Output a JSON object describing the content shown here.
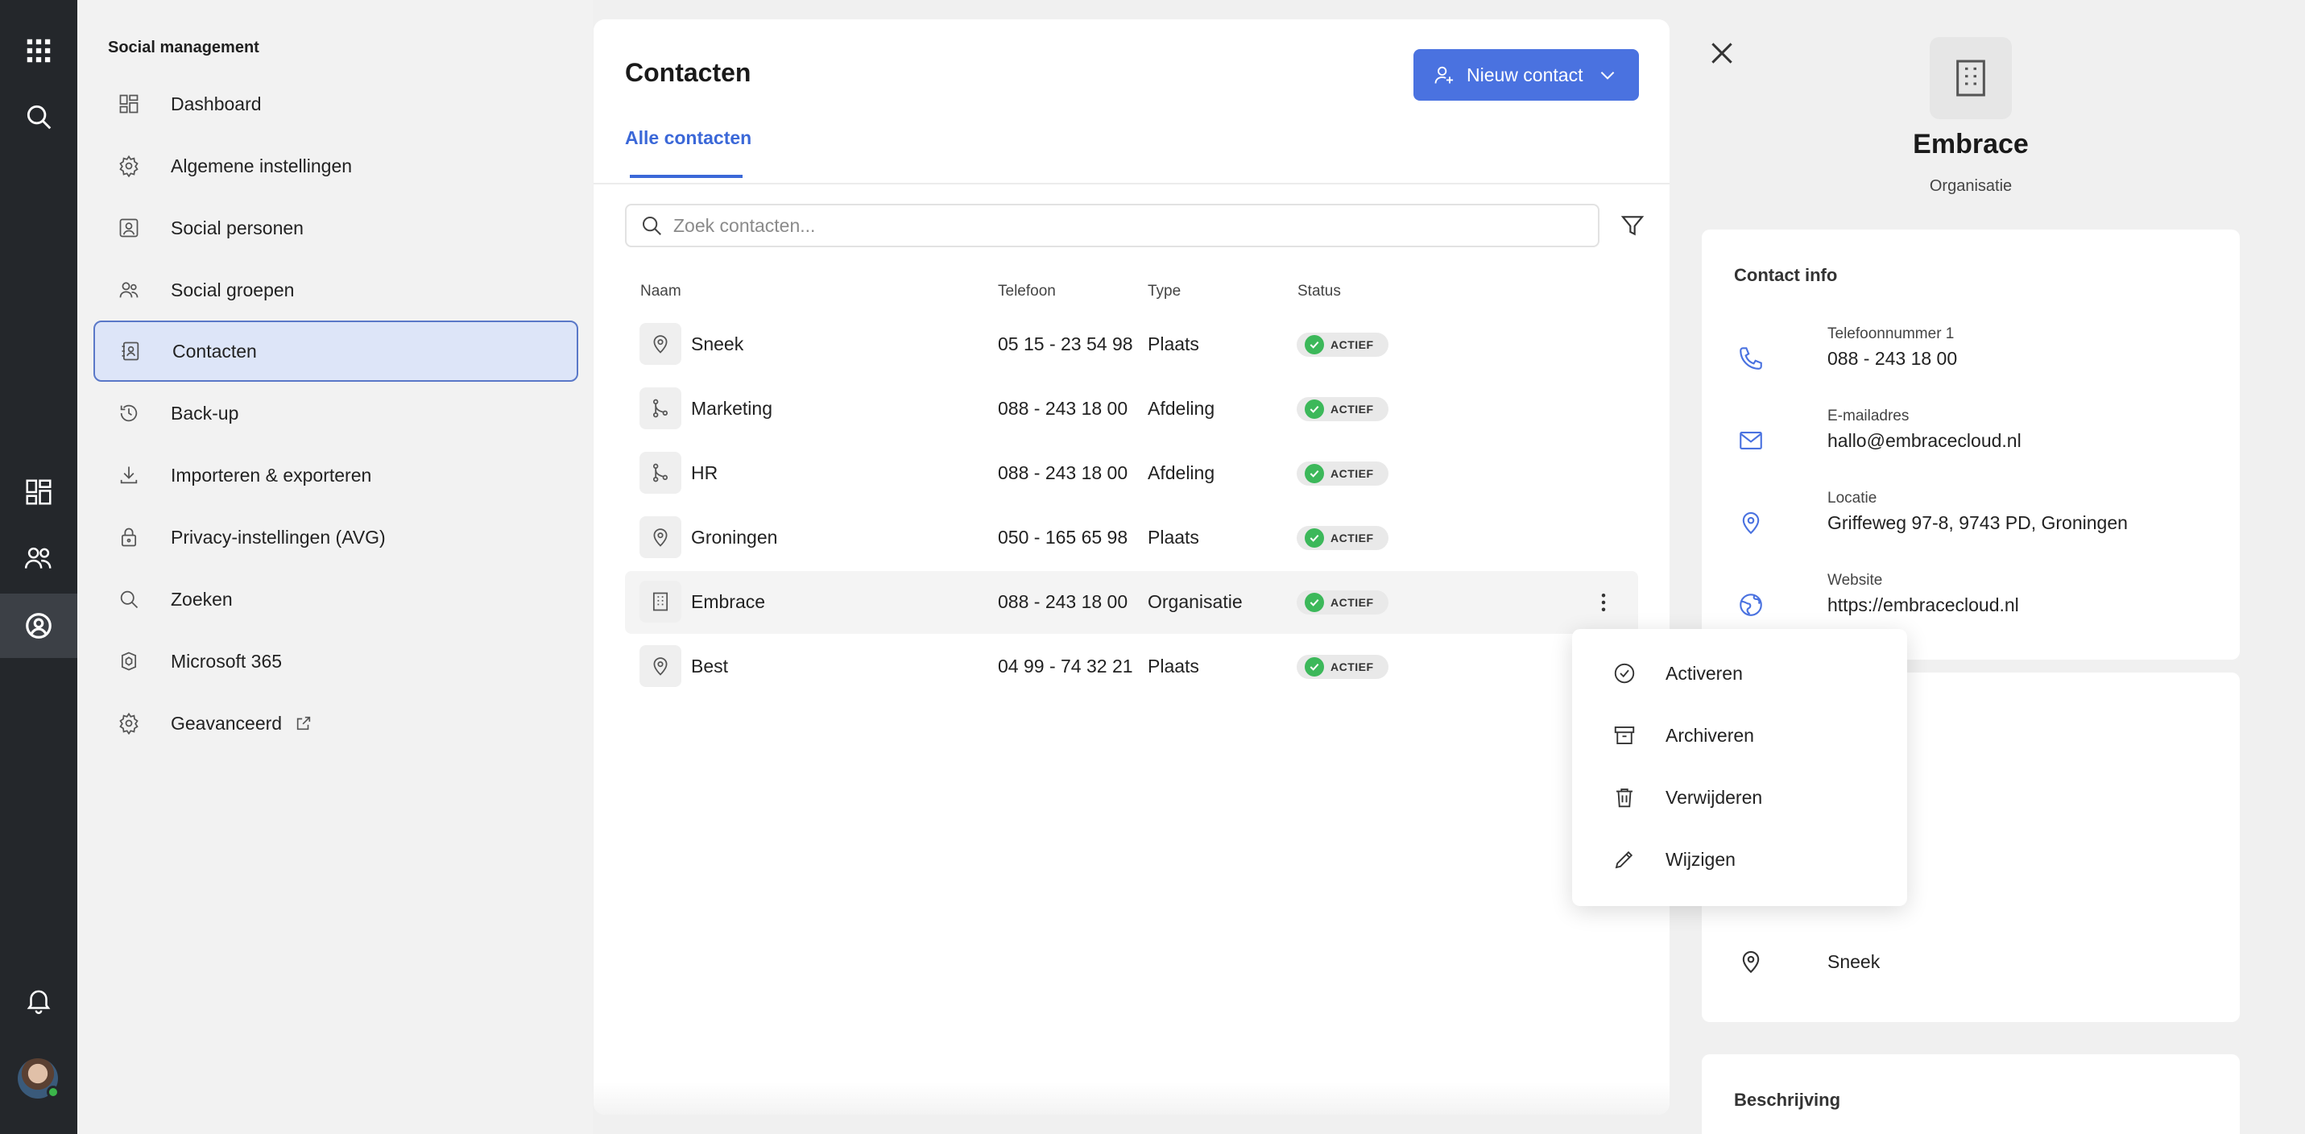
{
  "rail": {
    "icons": [
      "apps-grid-icon",
      "search-icon",
      "dashboard-icon",
      "people-icon",
      "contacts-icon",
      "bell-icon",
      "avatar"
    ]
  },
  "sidebar": {
    "title": "Social management",
    "items": [
      {
        "label": "Dashboard",
        "icon": "dashboard-icon"
      },
      {
        "label": "Algemene instellingen",
        "icon": "gear-icon"
      },
      {
        "label": "Social personen",
        "icon": "person-card-icon"
      },
      {
        "label": "Social groepen",
        "icon": "people-icon"
      },
      {
        "label": "Contacten",
        "icon": "contact-book-icon",
        "active": true
      },
      {
        "label": "Back-up",
        "icon": "history-icon"
      },
      {
        "label": "Importeren & exporteren",
        "icon": "download-icon"
      },
      {
        "label": "Privacy-instellingen (AVG)",
        "icon": "lock-icon"
      },
      {
        "label": "Zoeken",
        "icon": "search-icon"
      },
      {
        "label": "Microsoft 365",
        "icon": "office-icon"
      },
      {
        "label": "Geavanceerd",
        "icon": "gear-icon",
        "external": true
      }
    ]
  },
  "main": {
    "title": "Contacten",
    "new_button": "Nieuw contact",
    "tabs": [
      {
        "label": "Alle contacten",
        "active": true
      }
    ],
    "search_placeholder": "Zoek contacten...",
    "columns": [
      "Naam",
      "Telefoon",
      "Type",
      "Status"
    ],
    "rows": [
      {
        "name": "Sneek",
        "phone": "05 15 - 23 54 98",
        "type": "Plaats",
        "status": "ACTIEF",
        "icon": "location-pin-icon"
      },
      {
        "name": "Marketing",
        "phone": "088 - 243 18 00",
        "type": "Afdeling",
        "status": "ACTIEF",
        "icon": "branch-icon"
      },
      {
        "name": "HR",
        "phone": "088 - 243 18 00",
        "type": "Afdeling",
        "status": "ACTIEF",
        "icon": "branch-icon"
      },
      {
        "name": "Groningen",
        "phone": "050 - 165 65 98",
        "type": "Plaats",
        "status": "ACTIEF",
        "icon": "location-pin-icon"
      },
      {
        "name": "Embrace",
        "phone": "088 - 243 18 00",
        "type": "Organisatie",
        "status": "ACTIEF",
        "icon": "building-icon",
        "hovered": true
      },
      {
        "name": "Best",
        "phone": "04 99 - 74 32 21",
        "type": "Plaats",
        "status": "ACTIEF",
        "icon": "location-pin-icon"
      }
    ]
  },
  "menu": {
    "items": [
      {
        "label": "Activeren",
        "icon": "check-circle-icon"
      },
      {
        "label": "Archiveren",
        "icon": "archive-icon"
      },
      {
        "label": "Verwijderen",
        "icon": "trash-icon"
      },
      {
        "label": "Wijzigen",
        "icon": "pencil-icon"
      }
    ]
  },
  "detail": {
    "name": "Embrace",
    "type": "Organisatie",
    "contact_info_title": "Contact info",
    "fields": [
      {
        "label": "Telefoonnummer 1",
        "value": "088 - 243 18 00",
        "icon": "phone-icon"
      },
      {
        "label": "E-mailadres",
        "value": "hallo@embracecloud.nl",
        "icon": "mail-icon"
      },
      {
        "label": "Locatie",
        "value": "Griffeweg 97-8, 9743 PD, Groningen",
        "icon": "location-pin-icon"
      },
      {
        "label": "Website",
        "value": "https://embracecloud.nl",
        "icon": "globe-icon"
      }
    ],
    "linked_location": "Sneek",
    "description_title": "Beschrijving"
  },
  "colors": {
    "accent": "#4a72e0",
    "rail_bg": "#24272b",
    "status_green": "#3cb85a",
    "active_item_bg": "#dde5f8"
  }
}
